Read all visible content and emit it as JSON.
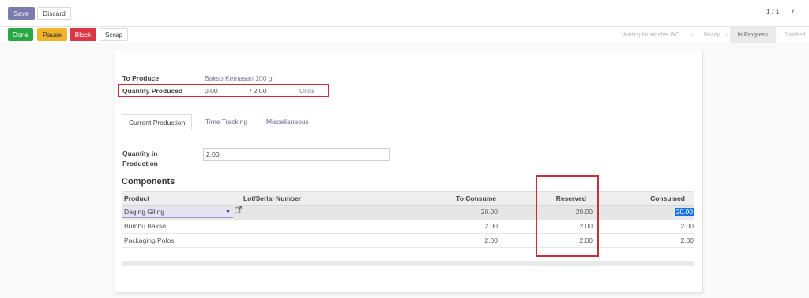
{
  "toolbar": {
    "save_label": "Save",
    "discard_label": "Discard",
    "pager": "1 / 1",
    "prev_icon": "chevron-left-icon"
  },
  "actions": {
    "done": "Done",
    "pause": "Pause",
    "block": "Block",
    "scrap": "Scrap"
  },
  "stages": [
    "Waiting for another WO",
    "Ready",
    "In Progress",
    "Finished"
  ],
  "active_stage": "In Progress",
  "form": {
    "to_produce_label": "To Produce",
    "to_produce_value": "Bakso Kemasan 100 gr",
    "qty_produced_label": "Quantity Produced",
    "qty_produced_value": "0.00",
    "qty_produced_total": "/ 2.00",
    "qty_produced_unit": "Units"
  },
  "tabs": [
    "Current Production",
    "Time Tracking",
    "Miscellaneous"
  ],
  "qty_in_production": {
    "label_line1": "Quantity in",
    "label_line2": "Production",
    "value": "2.00"
  },
  "components": {
    "title": "Components",
    "headers": {
      "product": "Product",
      "lot": "Lot/Serial Number",
      "to_consume": "To Consume",
      "reserved": "Reserved",
      "consumed": "Consumed"
    },
    "rows": [
      {
        "product": "Daging Giling",
        "to_consume": "20.00",
        "reserved": "20.00",
        "consumed": "20.00"
      },
      {
        "product": "Bumbu Bakso",
        "to_consume": "2.00",
        "reserved": "2.00",
        "consumed": "2.00"
      },
      {
        "product": "Packaging Polos",
        "to_consume": "2.00",
        "reserved": "2.00",
        "consumed": "2.00"
      }
    ]
  },
  "colors": {
    "primary": "#7c7bad",
    "done": "#28a745",
    "pause": "#f0b429",
    "block": "#dc3545",
    "annotation": "#c62f3a",
    "selection": "#1a73e8"
  }
}
